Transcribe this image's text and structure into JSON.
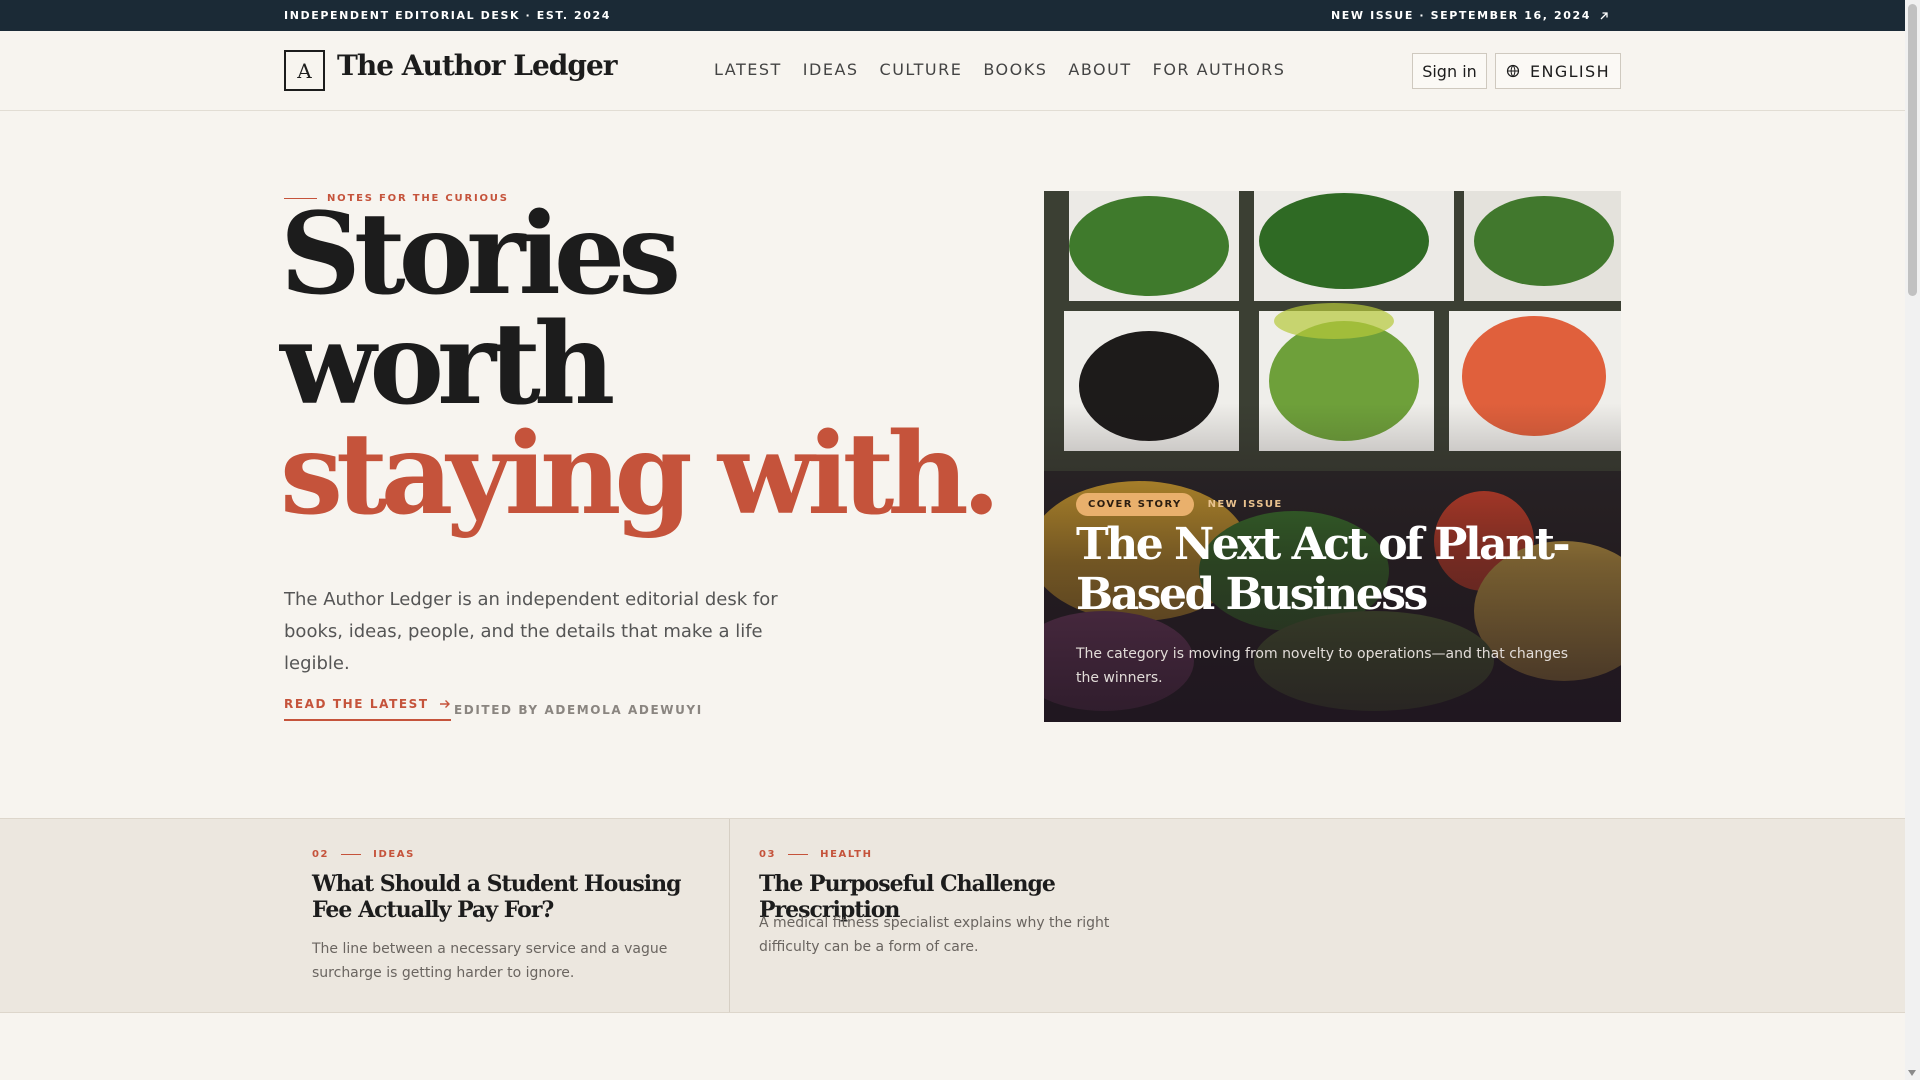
{
  "topbar": {
    "left_text": "INDEPENDENT EDITORIAL DESK · EST. 2024",
    "right_text": "NEW ISSUE · SEPTEMBER 16, 2024",
    "right_icon": "arrow-up-right-icon"
  },
  "header": {
    "logo_letter": "A",
    "logo_text": "The Author Ledger",
    "nav": [
      "LATEST",
      "IDEAS",
      "CULTURE",
      "BOOKS",
      "ABOUT",
      "FOR AUTHORS"
    ],
    "signin_label": "Sign in",
    "language_label": "ENGLISH",
    "language_icon": "globe-icon"
  },
  "hero": {
    "kicker": "NOTES FOR THE CURIOUS",
    "title_line1": "Stories",
    "title_line2": "worth",
    "title_line3": "staying with.",
    "intro": "The Author Ledger is an independent editorial desk for books, ideas, people, and the details that make a life legible.",
    "cta_label": "READ THE LATEST",
    "edited_by": "EDITED BY ADEMOLA ADEWUYI"
  },
  "cover": {
    "badge": "COVER STORY",
    "tag": "NEW ISSUE",
    "title": "The Next Act of Plant-Based Business",
    "dek": "The category is moving from novelty to operations—and that changes the winners."
  },
  "stories": [
    {
      "number": "02",
      "category": "IDEAS",
      "title": "What Should a Student Housing Fee Actually Pay For?",
      "dek": "The line between a necessary service and a vague surcharge is getting harder to ignore."
    },
    {
      "number": "03",
      "category": "HEALTH",
      "title": "The Purposeful Challenge Prescription",
      "dek": "A medical fitness specialist explains why the right difficulty can be a form of care."
    }
  ],
  "colors": {
    "accent": "#c5533b",
    "topbar": "#1b2a36",
    "background": "#f7f4ef",
    "badge": "#e9b06c"
  }
}
